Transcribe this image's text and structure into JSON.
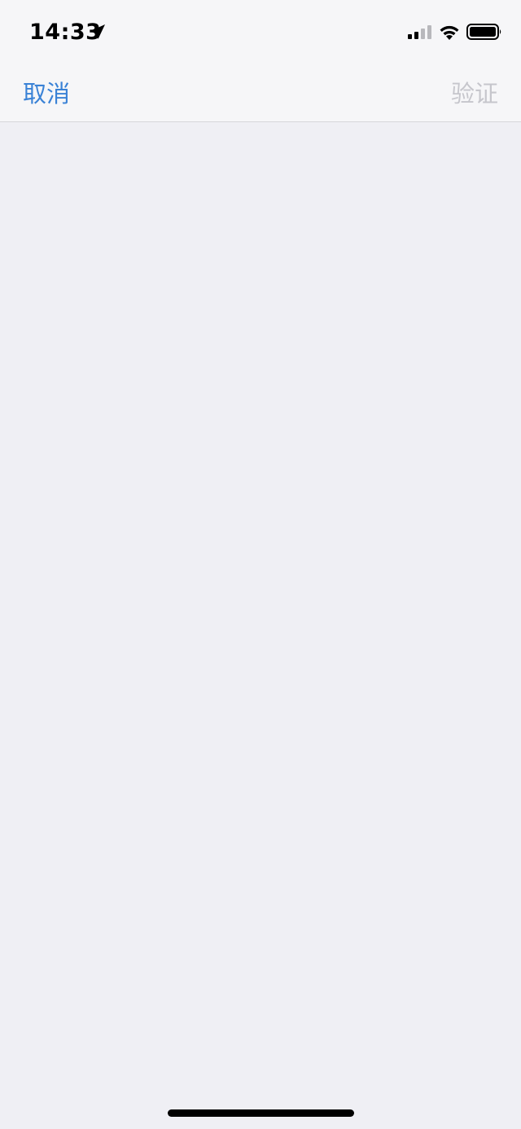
{
  "status_bar": {
    "time": "14:33",
    "icons": {
      "location": "location-arrow-icon",
      "signal": "cellular-signal-icon",
      "wifi": "wifi-icon",
      "battery": "battery-icon"
    },
    "signal_level": 0.5,
    "battery_level": 0.95
  },
  "nav_bar": {
    "cancel_label": "取消",
    "verify_label": "验证"
  },
  "colors": {
    "accent": "#3a82d6",
    "disabled": "#c6c6cc",
    "background": "#efeff4",
    "bar_background": "#f6f6f8"
  }
}
